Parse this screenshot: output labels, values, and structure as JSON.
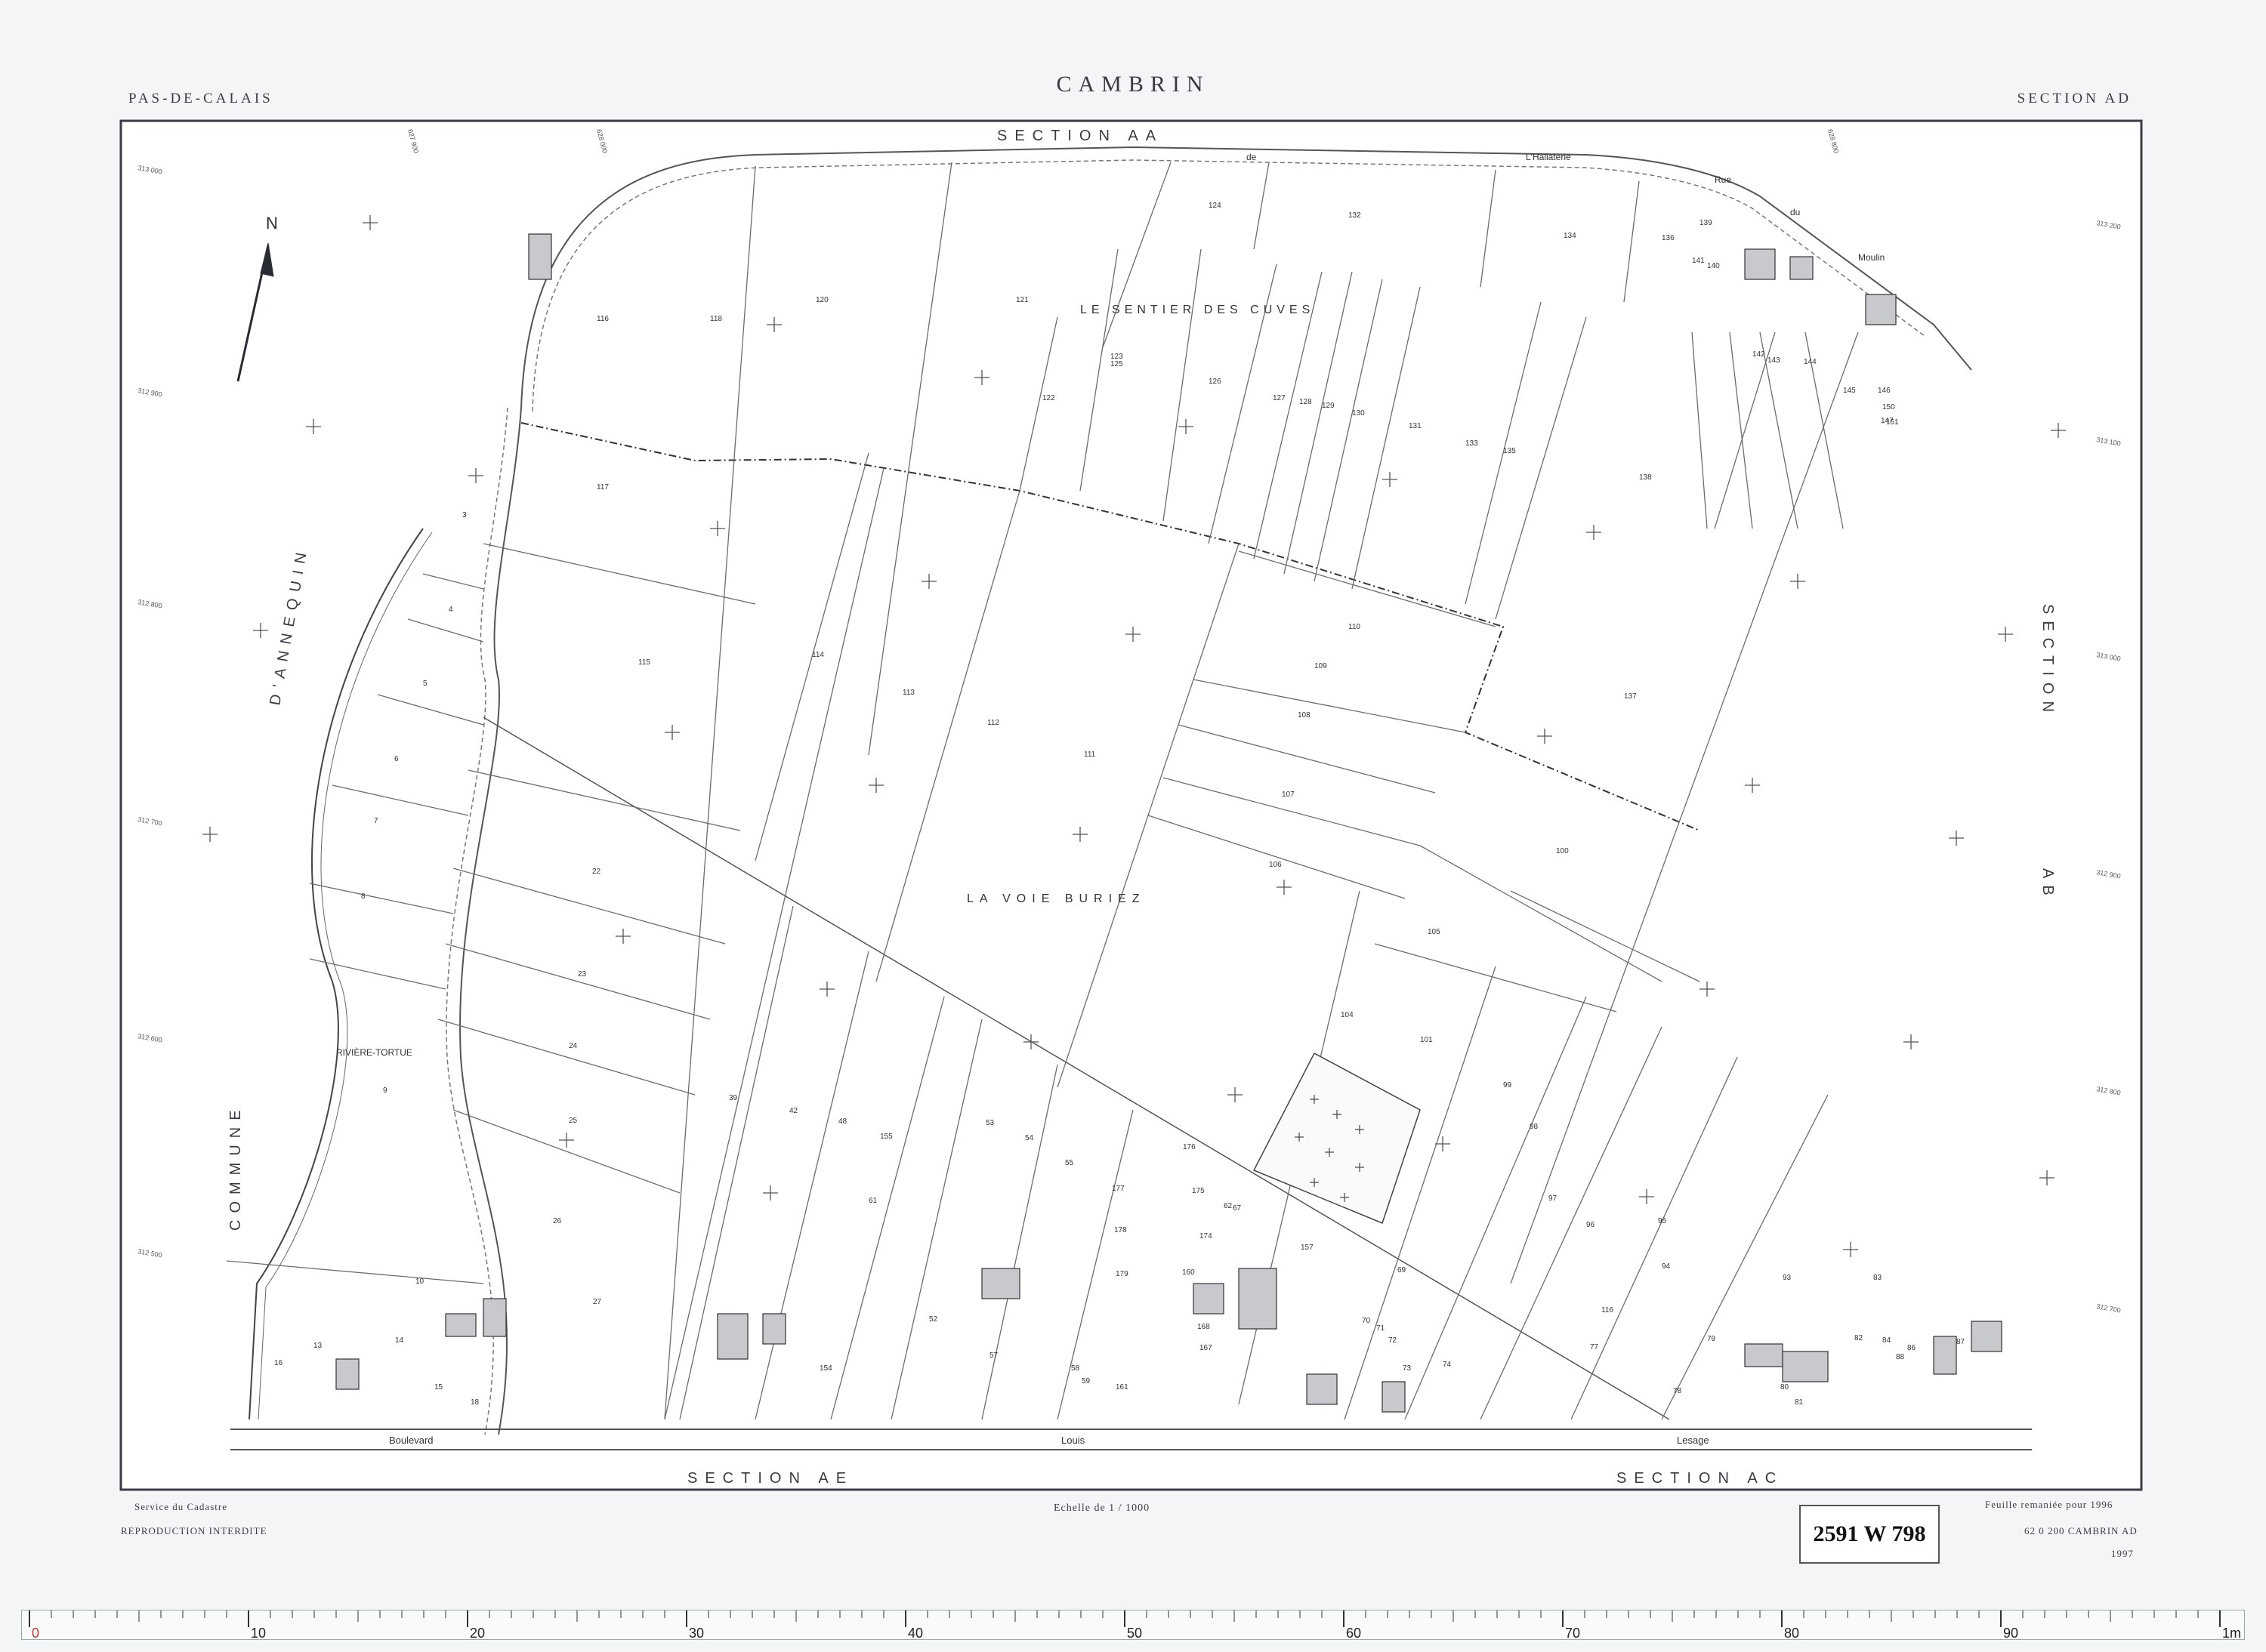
{
  "header": {
    "title": "CAMBRIN",
    "department": "PAS-DE-CALAIS",
    "section": "SECTION AD"
  },
  "map": {
    "north_label": "N",
    "boundary_labels": {
      "top": "SECTION AA",
      "right_upper": "SECTION",
      "right_lower": "AB",
      "left_upper": "D'ANNEQUIN",
      "left_lower": "COMMUNE",
      "bottom_left": "SECTION AE",
      "bottom_right": "SECTION AC"
    },
    "localities": [
      "LE SENTIER DES CUVES",
      "LA VOIE BURIEZ"
    ],
    "river_label": "RIVIÈRE-TORTUE",
    "street_labels": [
      "Boulevard",
      "Louis",
      "Lesage",
      "de",
      "L'Hallaterie",
      "Rue",
      "du",
      "Moulin"
    ],
    "parcels": [
      {
        "id": "1",
        "label": "116"
      },
      {
        "id": "2",
        "label": "118"
      },
      {
        "id": "3",
        "label": "120"
      },
      {
        "id": "4",
        "label": "121"
      },
      {
        "id": "5",
        "label": "122"
      },
      {
        "id": "6",
        "label": "123"
      },
      {
        "id": "7",
        "label": "124"
      },
      {
        "id": "8",
        "label": "125"
      },
      {
        "id": "9",
        "label": "126"
      },
      {
        "id": "10",
        "label": "127"
      },
      {
        "id": "11",
        "label": "128"
      },
      {
        "id": "12",
        "label": "129"
      },
      {
        "id": "13",
        "label": "130"
      },
      {
        "id": "14",
        "label": "131"
      },
      {
        "id": "15",
        "label": "132"
      },
      {
        "id": "16",
        "label": "133"
      },
      {
        "id": "17",
        "label": "134"
      },
      {
        "id": "18",
        "label": "135"
      },
      {
        "id": "19",
        "label": "136"
      },
      {
        "id": "20",
        "label": "137"
      },
      {
        "id": "21",
        "label": "138"
      },
      {
        "id": "22",
        "label": "139"
      },
      {
        "id": "23",
        "label": "140"
      },
      {
        "id": "24",
        "label": "141"
      },
      {
        "id": "25",
        "label": "142"
      },
      {
        "id": "26",
        "label": "143"
      },
      {
        "id": "27",
        "label": "144"
      },
      {
        "id": "28",
        "label": "145"
      },
      {
        "id": "29",
        "label": "146"
      },
      {
        "id": "30",
        "label": "147"
      },
      {
        "id": "31",
        "label": "150"
      },
      {
        "id": "32",
        "label": "151"
      },
      {
        "id": "33",
        "label": "117"
      },
      {
        "id": "34",
        "label": "115"
      },
      {
        "id": "35",
        "label": "114"
      },
      {
        "id": "36",
        "label": "113"
      },
      {
        "id": "37",
        "label": "112"
      },
      {
        "id": "38",
        "label": "111"
      },
      {
        "id": "39",
        "label": "110"
      },
      {
        "id": "40",
        "label": "109"
      },
      {
        "id": "41",
        "label": "108"
      },
      {
        "id": "42",
        "label": "107"
      },
      {
        "id": "43",
        "label": "106"
      },
      {
        "id": "44",
        "label": "105"
      },
      {
        "id": "45",
        "label": "104"
      },
      {
        "id": "46",
        "label": "101"
      },
      {
        "id": "47",
        "label": "100"
      },
      {
        "id": "48",
        "label": "99"
      },
      {
        "id": "49",
        "label": "98"
      },
      {
        "id": "50",
        "label": "97"
      },
      {
        "id": "51",
        "label": "96"
      },
      {
        "id": "52",
        "label": "95"
      },
      {
        "id": "53",
        "label": "94"
      },
      {
        "id": "54",
        "label": "93"
      },
      {
        "id": "55",
        "label": "3"
      },
      {
        "id": "56",
        "label": "4"
      },
      {
        "id": "57",
        "label": "5"
      },
      {
        "id": "58",
        "label": "6"
      },
      {
        "id": "59",
        "label": "7"
      },
      {
        "id": "60",
        "label": "8"
      },
      {
        "id": "61",
        "label": "9"
      },
      {
        "id": "62",
        "label": "22"
      },
      {
        "id": "63",
        "label": "23"
      },
      {
        "id": "64",
        "label": "24"
      },
      {
        "id": "65",
        "label": "25"
      },
      {
        "id": "66",
        "label": "26"
      },
      {
        "id": "67",
        "label": "39"
      },
      {
        "id": "68",
        "label": "42"
      },
      {
        "id": "69",
        "label": "48"
      },
      {
        "id": "70",
        "label": "155"
      },
      {
        "id": "71",
        "label": "53"
      },
      {
        "id": "72",
        "label": "54"
      },
      {
        "id": "73",
        "label": "55"
      },
      {
        "id": "74",
        "label": "61"
      },
      {
        "id": "75",
        "label": "67"
      },
      {
        "id": "76",
        "label": "157"
      },
      {
        "id": "77",
        "label": "10"
      },
      {
        "id": "78",
        "label": "14"
      },
      {
        "id": "79",
        "label": "13"
      },
      {
        "id": "80",
        "label": "15"
      },
      {
        "id": "81",
        "label": "16"
      },
      {
        "id": "82",
        "label": "18"
      },
      {
        "id": "83",
        "label": "27"
      },
      {
        "id": "84",
        "label": "154"
      },
      {
        "id": "85",
        "label": "52"
      },
      {
        "id": "86",
        "label": "57"
      },
      {
        "id": "87",
        "label": "58"
      },
      {
        "id": "88",
        "label": "59"
      },
      {
        "id": "89",
        "label": "161"
      },
      {
        "id": "90",
        "label": "167"
      },
      {
        "id": "91",
        "label": "168"
      },
      {
        "id": "92",
        "label": "160"
      },
      {
        "id": "93",
        "label": "174"
      },
      {
        "id": "94",
        "label": "175"
      },
      {
        "id": "95",
        "label": "176"
      },
      {
        "id": "96",
        "label": "177"
      },
      {
        "id": "97",
        "label": "178"
      },
      {
        "id": "98",
        "label": "179"
      },
      {
        "id": "99",
        "label": "62"
      },
      {
        "id": "100",
        "label": "69"
      },
      {
        "id": "101",
        "label": "70"
      },
      {
        "id": "102",
        "label": "71"
      },
      {
        "id": "103",
        "label": "72"
      },
      {
        "id": "104",
        "label": "73"
      },
      {
        "id": "105",
        "label": "74"
      },
      {
        "id": "106",
        "label": "77"
      },
      {
        "id": "107",
        "label": "78"
      },
      {
        "id": "108",
        "label": "79"
      },
      {
        "id": "109",
        "label": "80"
      },
      {
        "id": "110",
        "label": "81"
      },
      {
        "id": "111",
        "label": "82"
      },
      {
        "id": "112",
        "label": "83"
      },
      {
        "id": "113",
        "label": "84"
      },
      {
        "id": "114",
        "label": "86"
      },
      {
        "id": "115",
        "label": "87"
      },
      {
        "id": "116",
        "label": "88"
      },
      {
        "id": "117",
        "label": "116"
      }
    ],
    "grid_coords_left": [
      "313 000",
      "312 900",
      "312 800",
      "312 700",
      "312 600",
      "312 500"
    ],
    "grid_coords_right": [
      "313 200",
      "313 100",
      "313 000",
      "312 900",
      "312 800",
      "312 700"
    ],
    "grid_coords_top": [
      "627 900",
      "628 000",
      "628 800"
    ]
  },
  "footer": {
    "service": "Service du Cadastre",
    "reproduction": "REPRODUCTION INTERDITE",
    "scale": "Echelle de 1 / 1000",
    "revision": "Feuille remaniée pour 1996",
    "sheet_code": "62 0 200 CAMBRIN AD",
    "year": "1997",
    "archive_label": "2591 W 798"
  },
  "ruler": {
    "major_labels": [
      "0",
      "10",
      "20",
      "30",
      "40",
      "50",
      "60",
      "70",
      "80",
      "90",
      "1m"
    ]
  }
}
